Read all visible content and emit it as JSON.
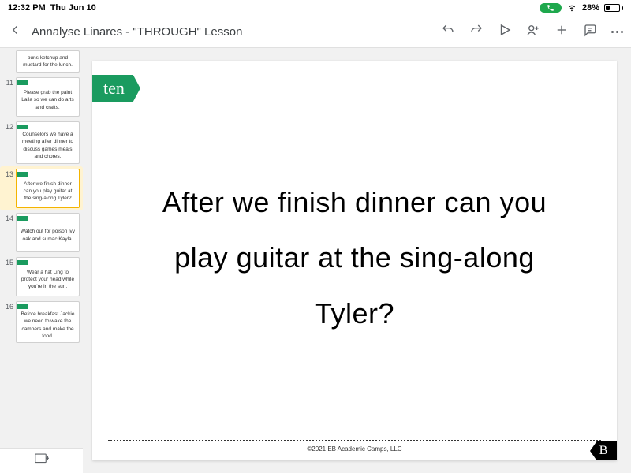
{
  "status": {
    "time": "12:32 PM",
    "date": "Thu Jun 10",
    "battery_pct": "28%"
  },
  "header": {
    "title": "Annalyse Linares -  \"THROUGH\" Lesson"
  },
  "sidebar": {
    "thumbs": [
      {
        "num": "",
        "text": "buns ketchup and mustard for the lunch.",
        "partial": true
      },
      {
        "num": "11",
        "text": "Please grab the paint Laila so we can do arts and crafts."
      },
      {
        "num": "12",
        "text": "Counselors we have a meeting after dinner to discuss games meals and chores."
      },
      {
        "num": "13",
        "text": "After we finish dinner can you play guitar at the sing-along Tyler?",
        "selected": true
      },
      {
        "num": "14",
        "text": "Watch out for poison ivy oak and sumac Kayla."
      },
      {
        "num": "15",
        "text": "Wear a hat Ling to protect your head while you're in the sun."
      },
      {
        "num": "16",
        "text": "Before breakfast Jackie we need to wake the campers and make the food."
      }
    ]
  },
  "slide": {
    "tag": "ten",
    "text": "After we finish dinner can you play guitar at the sing-along Tyler?",
    "copyright": "©2021 EB Academic Camps, LLC",
    "badge": "B"
  }
}
